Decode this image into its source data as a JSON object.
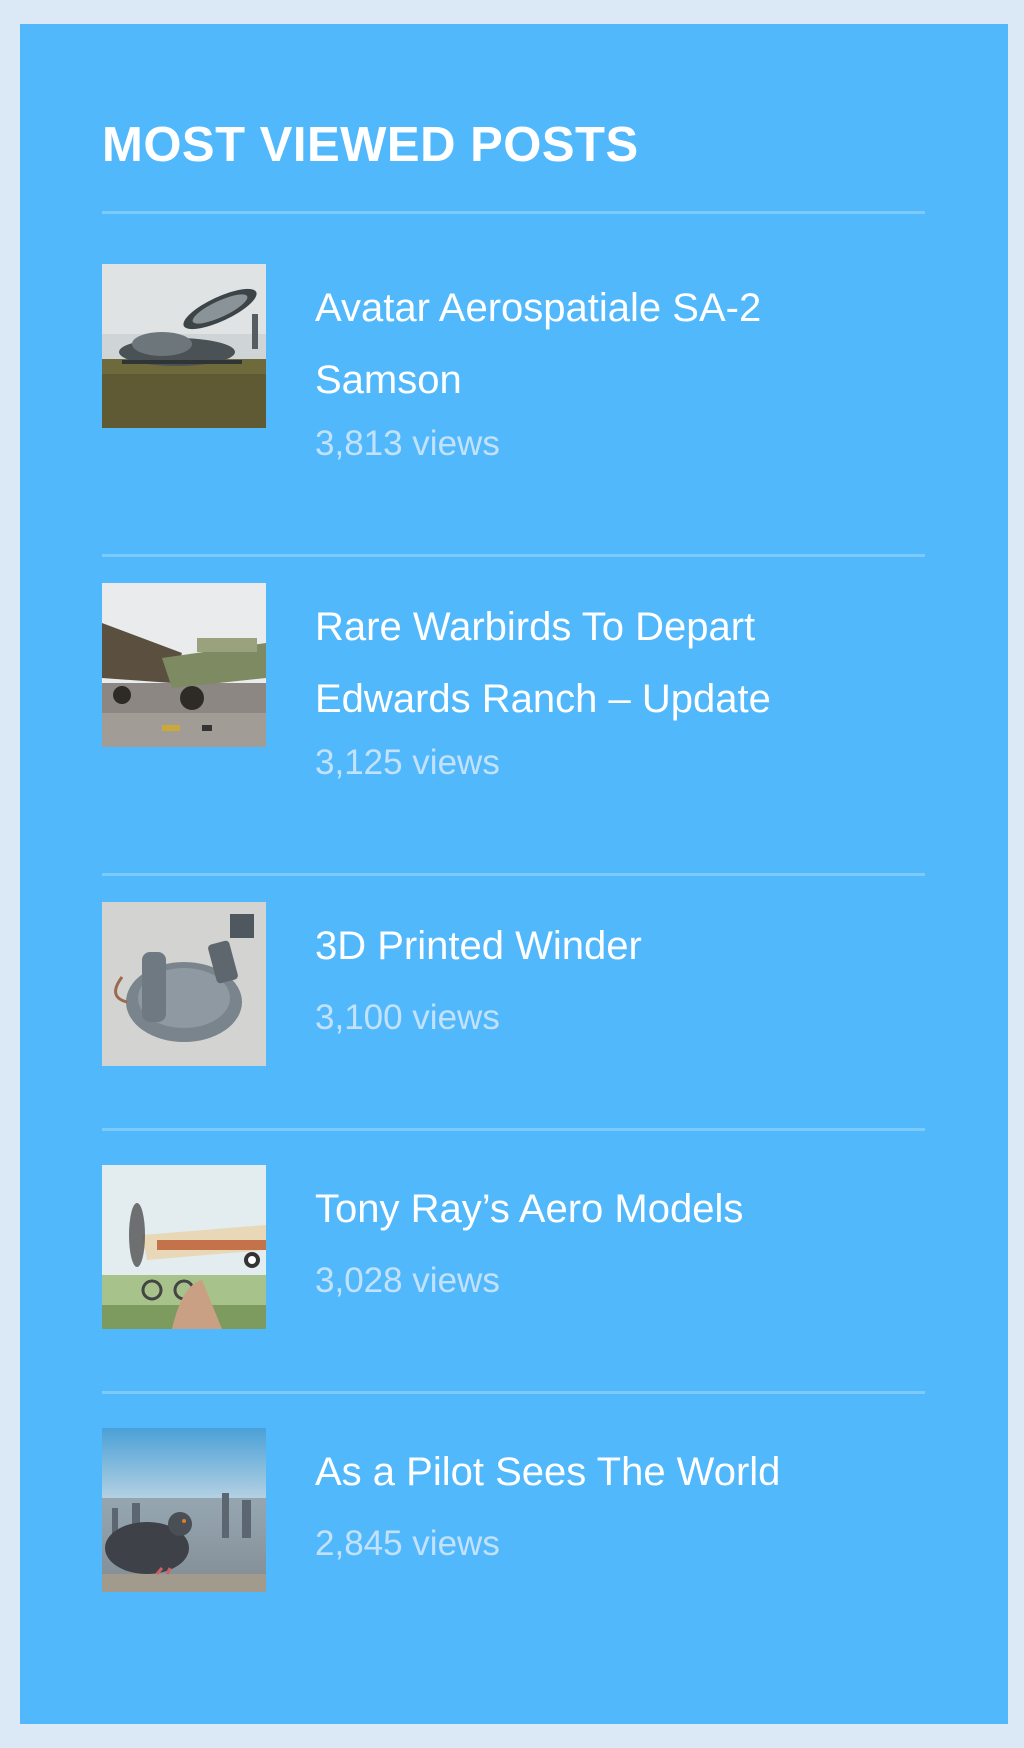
{
  "widget": {
    "title": "MOST VIEWED POSTS"
  },
  "posts": [
    {
      "title": "Avatar Aerospatiale SA-2 Samson",
      "views": "3,813 views",
      "thumbnail_icon": "aircraft-photo-icon"
    },
    {
      "title": "Rare Warbirds To Depart Edwards Ranch – Update",
      "views": "3,125 views",
      "thumbnail_icon": "warbird-photo-icon"
    },
    {
      "title": "3D Printed Winder",
      "views": "3,100 views",
      "thumbnail_icon": "winder-photo-icon"
    },
    {
      "title": "Tony Ray’s Aero Models",
      "views": "3,028 views",
      "thumbnail_icon": "model-plane-photo-icon"
    },
    {
      "title": "As a Pilot Sees The World",
      "views": "2,845 views",
      "thumbnail_icon": "pigeon-city-photo-icon"
    }
  ],
  "colors": {
    "page_background": "#dbe9f7",
    "widget_background": "#52b8fc",
    "title_text": "#ffffff",
    "views_text": "#c2e2fb"
  }
}
